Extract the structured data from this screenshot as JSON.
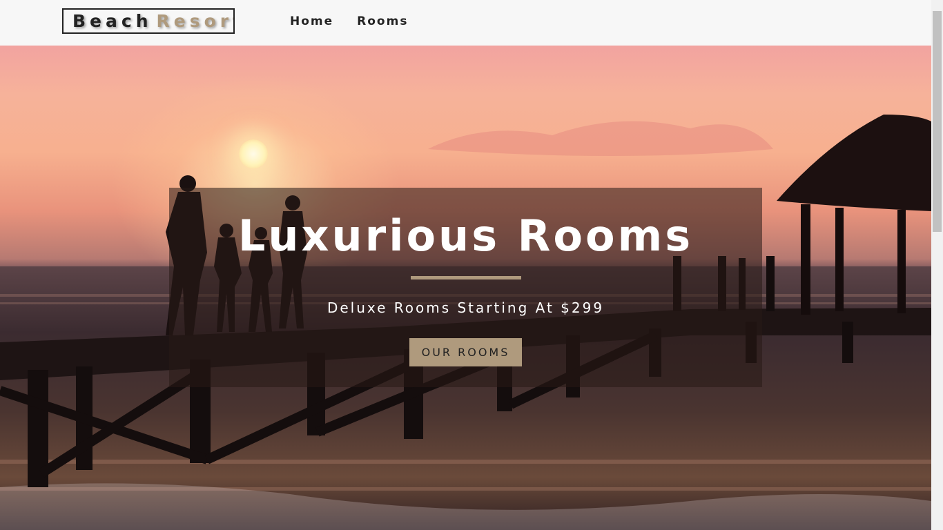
{
  "navbar": {
    "logo_part1": "Beach",
    "logo_part2": "Resort",
    "links": [
      {
        "label": "Home"
      },
      {
        "label": "Rooms"
      }
    ]
  },
  "hero": {
    "title": "Luxurious Rooms",
    "subtitle": "Deluxe Rooms Starting At $299",
    "button_label": "OUR ROOMS"
  },
  "colors": {
    "accent": "#af9a7d",
    "dark": "#222222",
    "navbar_bg": "#f7f7f7"
  }
}
